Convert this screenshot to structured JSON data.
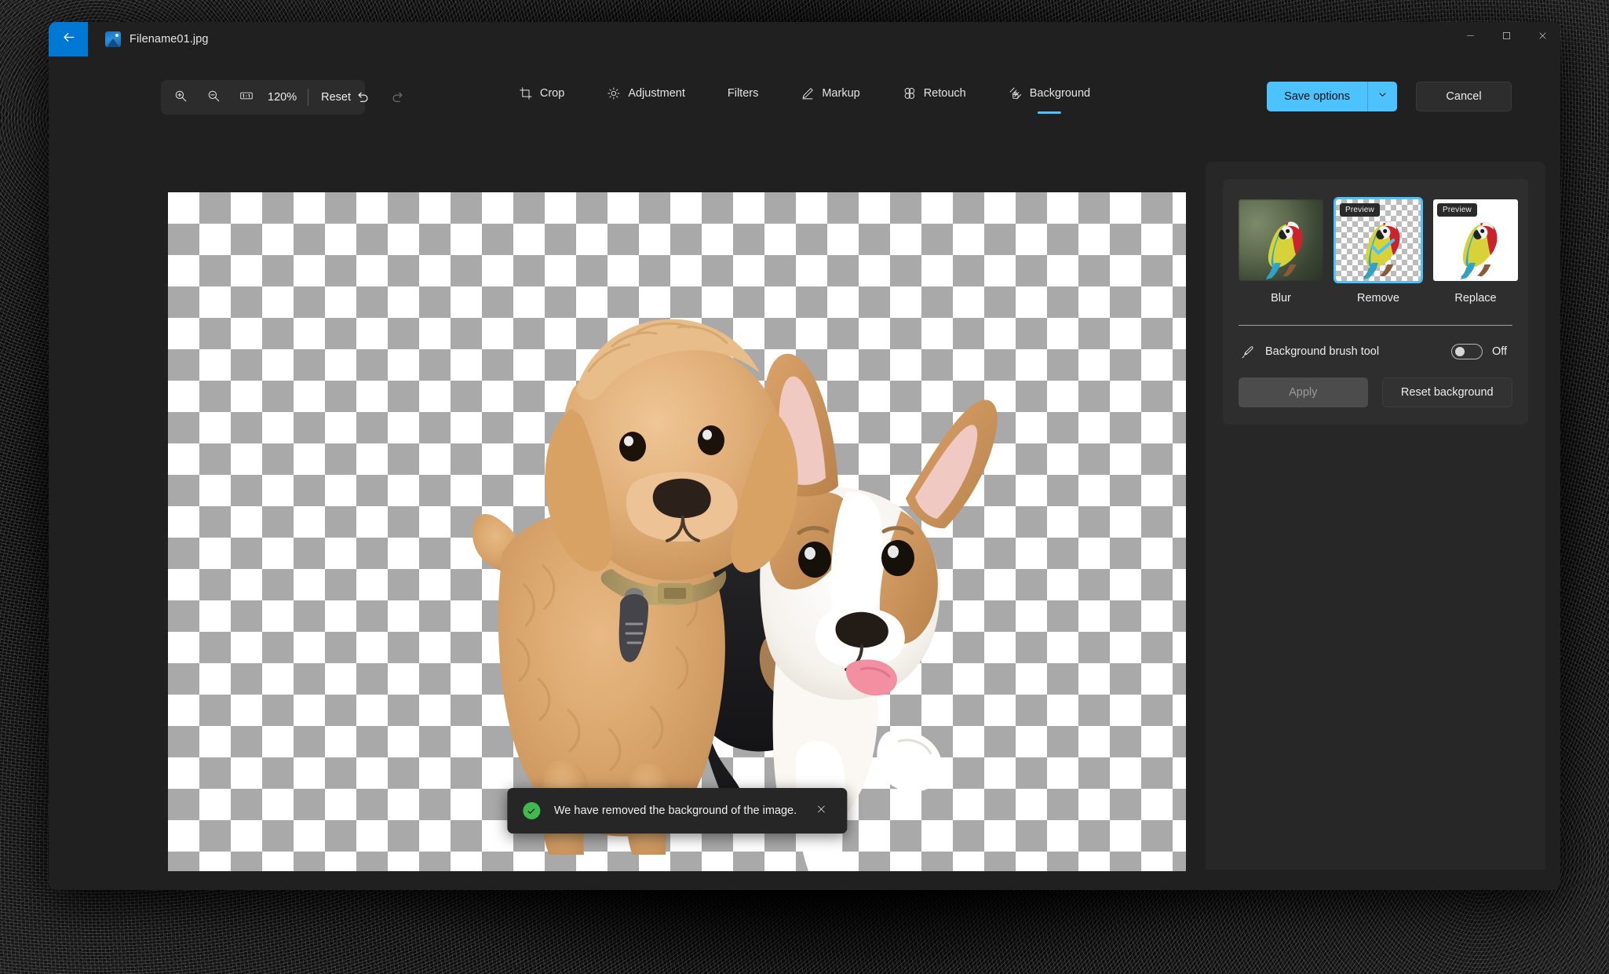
{
  "window": {
    "title": "Filename01.jpg",
    "back_icon": "arrow-left-icon",
    "file_icon": "image-file-icon",
    "minimize_label": "Minimize",
    "maximize_label": "Maximize",
    "close_label": "Close",
    "accent_blue": "#0078d4",
    "accent_light_blue": "#4cc2ff"
  },
  "toolbar": {
    "zoom_in_icon": "zoom-in-icon",
    "zoom_out_icon": "zoom-out-icon",
    "actual_size_icon": "one-to-one-icon",
    "actual_size_label": "1:1",
    "zoom_level": "120%",
    "reset_label": "Reset",
    "undo_icon": "undo-icon",
    "redo_icon": "redo-icon",
    "undo_enabled": "true",
    "redo_enabled": "false",
    "save_options_label": "Save options",
    "save_options_chevron": "chevron-down-icon",
    "cancel_label": "Cancel"
  },
  "tabs": [
    {
      "label": "Crop",
      "icon": "crop-icon",
      "active": "false"
    },
    {
      "label": "Adjustment",
      "icon": "brightness-icon",
      "active": "false"
    },
    {
      "label": "Filters",
      "icon": "",
      "active": "false"
    },
    {
      "label": "Markup",
      "icon": "pencil-icon",
      "active": "false"
    },
    {
      "label": "Retouch",
      "icon": "retouch-icon",
      "active": "false"
    },
    {
      "label": "Background",
      "icon": "background-icon",
      "active": "true"
    }
  ],
  "canvas": {
    "transparency_checker_light": "#ffffff",
    "transparency_checker_dark": "#a9a9a9",
    "checker_square_px": "40",
    "subject_description": "Two puppies cut out on transparent background"
  },
  "toast": {
    "icon": "success-check-icon",
    "message": "We have removed the background of the image.",
    "close_icon": "close-icon",
    "success_color": "#3fb950"
  },
  "panel": {
    "background_options": [
      {
        "label": "Blur",
        "badge": "",
        "selected": "false",
        "style": "blurred-photo-thumbnail"
      },
      {
        "label": "Remove",
        "badge": "Preview",
        "selected": "true",
        "style": "transparent-checker-thumbnail"
      },
      {
        "label": "Replace",
        "badge": "Preview",
        "selected": "false",
        "style": "white-background-thumbnail"
      }
    ],
    "brush": {
      "icon": "paint-brush-icon",
      "label": "Background brush tool",
      "state_label": "Off",
      "enabled": "false"
    },
    "apply_label": "Apply",
    "apply_enabled": "false",
    "reset_background_label": "Reset background"
  }
}
